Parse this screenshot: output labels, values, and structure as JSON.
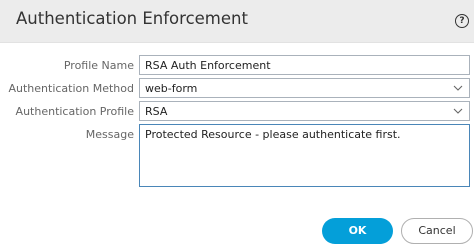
{
  "dialog": {
    "title": "Authentication Enforcement",
    "help_icon": "help-icon"
  },
  "form": {
    "profile_name": {
      "label": "Profile Name",
      "value": "RSA Auth Enforcement"
    },
    "authentication_method": {
      "label": "Authentication Method",
      "value": "web-form"
    },
    "authentication_profile": {
      "label": "Authentication Profile",
      "value": "RSA"
    },
    "message": {
      "label": "Message",
      "value": "Protected Resource - please authenticate first."
    }
  },
  "buttons": {
    "ok_label": "OK",
    "cancel_label": "Cancel"
  },
  "colors": {
    "titlebar_bg": "#ececec",
    "primary_button": "#049fd9",
    "focus_border": "#4a86b8"
  }
}
